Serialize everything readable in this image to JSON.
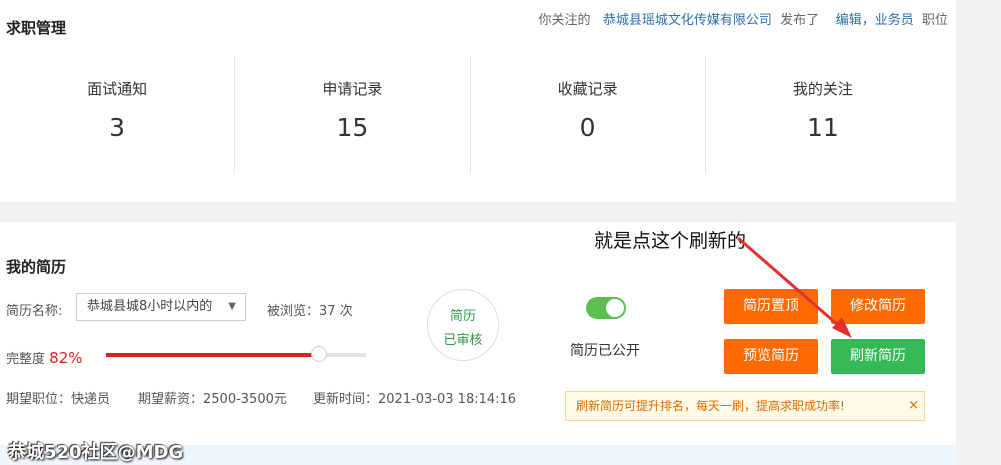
{
  "job_management": {
    "title": "求职管理",
    "notice": {
      "prefix": "你关注的",
      "company": "恭城县瑶城文化传媒有限公司",
      "middle": "发布了",
      "jobs": "编辑，业务员",
      "suffix": "职位"
    },
    "stats": [
      {
        "label": "面试通知",
        "value": "3"
      },
      {
        "label": "申请记录",
        "value": "15"
      },
      {
        "label": "收藏记录",
        "value": "0"
      },
      {
        "label": "我的关注",
        "value": "11"
      }
    ]
  },
  "annotation": "就是点这个刷新的",
  "my_resume": {
    "title": "我的简历",
    "name_label": "简历名称:",
    "name_value": "恭城县城8小时以内的",
    "views": "被浏览：37 次",
    "completeness_label": "完整度",
    "completeness_value": "82%",
    "completeness_fraction": 0.82,
    "status_line1": "简历",
    "status_line2": "已审核",
    "public_label": "简历已公开",
    "public_on": true,
    "expected_position": "期望职位：快递员",
    "expected_salary": "期望薪资：2500-3500元",
    "updated": "更新时间：2021-03-03 18:14:16",
    "buttons": {
      "top": "简历置顶",
      "edit": "修改简历",
      "preview": "预览简历",
      "refresh": "刷新简历"
    },
    "tip": "刷新简历可提升排名，每天一刷，提高求职成功率!",
    "tip_close": "×"
  },
  "watermark": "恭城520社区@MDG",
  "colors": {
    "orange": "#ff6a00",
    "green": "#34b954",
    "red": "#e01e1e",
    "link": "#2a6fb0"
  }
}
